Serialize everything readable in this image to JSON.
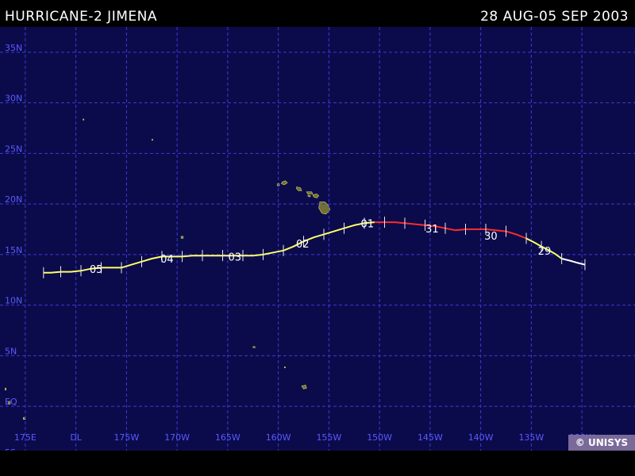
{
  "header": {
    "storm_title": "HURRICANE-2 JIMENA",
    "date_range": "28 AUG-05 SEP 2003"
  },
  "credit": "© UNISYS",
  "colors": {
    "ocean": "#0b0b4b",
    "grid": "#3a3ad8",
    "grid_label": "#5a5aff",
    "land": "#707034",
    "hurricane_track": "#ff2a2a",
    "storm_track": "#ffff66",
    "depression_track": "#ffffff",
    "day_label": "#ffffff"
  },
  "map_data": {
    "lat_labels": [
      "35N",
      "30N",
      "25N",
      "20N",
      "15N",
      "10N",
      "5N",
      "EQ",
      "5S"
    ],
    "lat_values": [
      35,
      30,
      25,
      20,
      15,
      10,
      5,
      0,
      -5
    ],
    "lon_labels": [
      "175E",
      "DL",
      "175W",
      "170W",
      "165W",
      "160W",
      "155W",
      "150W",
      "145W",
      "140W",
      "135W",
      "130W"
    ],
    "lon_values": [
      175,
      180,
      185,
      190,
      195,
      200,
      205,
      210,
      215,
      220,
      225,
      230
    ],
    "track_segments": [
      {
        "intensity": "depression",
        "points": [
          [
            230.3,
            14.0
          ],
          [
            229.5,
            14.2
          ],
          [
            228.8,
            14.4
          ],
          [
            228.0,
            14.6
          ]
        ]
      },
      {
        "intensity": "storm",
        "points": [
          [
            228.0,
            14.6
          ],
          [
            227.3,
            15.1
          ],
          [
            226.6,
            15.5
          ],
          [
            226.0,
            15.8
          ],
          [
            225.3,
            16.2
          ],
          [
            224.5,
            16.6
          ]
        ]
      },
      {
        "intensity": "hurricane",
        "points": [
          [
            224.5,
            16.6
          ],
          [
            223.5,
            17.0
          ],
          [
            222.5,
            17.3
          ],
          [
            221.5,
            17.4
          ],
          [
            220.5,
            17.5
          ],
          [
            219.5,
            17.5
          ],
          [
            218.5,
            17.5
          ],
          [
            217.5,
            17.4
          ],
          [
            216.5,
            17.6
          ],
          [
            215.5,
            17.8
          ],
          [
            214.5,
            17.9
          ],
          [
            213.5,
            18.0
          ],
          [
            212.5,
            18.1
          ],
          [
            211.5,
            18.2
          ],
          [
            210.5,
            18.2
          ],
          [
            209.5,
            18.2
          ]
        ]
      },
      {
        "intensity": "storm",
        "points": [
          [
            209.5,
            18.2
          ],
          [
            208.5,
            18.1
          ],
          [
            207.5,
            17.9
          ],
          [
            206.5,
            17.6
          ],
          [
            205.5,
            17.3
          ],
          [
            204.5,
            17.0
          ],
          [
            203.5,
            16.7
          ],
          [
            202.5,
            16.3
          ],
          [
            201.5,
            15.8
          ],
          [
            200.5,
            15.4
          ],
          [
            199.5,
            15.2
          ],
          [
            198.5,
            15.0
          ],
          [
            197.5,
            14.9
          ],
          [
            196.5,
            14.9
          ],
          [
            195.5,
            14.9
          ],
          [
            194.5,
            14.9
          ],
          [
            193.5,
            14.9
          ],
          [
            192.5,
            14.9
          ],
          [
            191.5,
            14.9
          ],
          [
            190.5,
            14.8
          ],
          [
            189.5,
            14.8
          ],
          [
            188.5,
            14.8
          ],
          [
            187.5,
            14.6
          ],
          [
            186.5,
            14.3
          ],
          [
            185.5,
            14.0
          ],
          [
            184.5,
            13.7
          ],
          [
            183.5,
            13.7
          ],
          [
            182.5,
            13.7
          ],
          [
            181.5,
            13.6
          ],
          [
            180.5,
            13.4
          ],
          [
            179.5,
            13.3
          ],
          [
            178.5,
            13.3
          ],
          [
            177.5,
            13.2
          ],
          [
            176.8,
            13.2
          ]
        ]
      }
    ],
    "six_hour_ticks": [
      [
        230.3,
        14.0
      ],
      [
        228.0,
        14.6
      ],
      [
        226.0,
        15.8
      ],
      [
        224.5,
        16.6
      ],
      [
        222.5,
        17.3
      ],
      [
        220.5,
        17.5
      ],
      [
        218.5,
        17.5
      ],
      [
        216.5,
        17.6
      ],
      [
        214.5,
        17.9
      ],
      [
        212.5,
        18.1
      ],
      [
        210.5,
        18.2
      ],
      [
        208.5,
        18.1
      ],
      [
        206.5,
        17.6
      ],
      [
        204.5,
        17.0
      ],
      [
        202.5,
        16.3
      ],
      [
        200.5,
        15.4
      ],
      [
        198.5,
        15.0
      ],
      [
        196.5,
        14.9
      ],
      [
        194.5,
        14.9
      ],
      [
        192.5,
        14.9
      ],
      [
        190.5,
        14.8
      ],
      [
        188.5,
        14.8
      ],
      [
        186.5,
        14.3
      ],
      [
        184.5,
        13.7
      ],
      [
        182.5,
        13.7
      ],
      [
        180.5,
        13.4
      ],
      [
        178.5,
        13.3
      ],
      [
        176.8,
        13.2
      ]
    ],
    "day_labels": [
      {
        "text": "29",
        "lon": 226.3,
        "lat": 15.0
      },
      {
        "text": "30",
        "lon": 221.0,
        "lat": 16.5
      },
      {
        "text": "31",
        "lon": 215.2,
        "lat": 17.2
      },
      {
        "text": "01",
        "lon": 208.8,
        "lat": 17.7
      },
      {
        "text": "02",
        "lon": 202.4,
        "lat": 15.7
      },
      {
        "text": "03",
        "lon": 195.7,
        "lat": 14.4
      },
      {
        "text": "04",
        "lon": 189.0,
        "lat": 14.2
      },
      {
        "text": "05",
        "lon": 182.0,
        "lat": 13.2
      }
    ],
    "land_features": [
      {
        "name": "Kauai",
        "points": [
          [
            200.4,
            22.2
          ],
          [
            200.7,
            22.3
          ],
          [
            200.9,
            22.1
          ],
          [
            200.6,
            21.9
          ],
          [
            200.3,
            22.0
          ]
        ]
      },
      {
        "name": "Niihau",
        "points": [
          [
            199.9,
            22.0
          ],
          [
            200.1,
            22.0
          ],
          [
            200.1,
            21.8
          ],
          [
            199.9,
            21.8
          ]
        ]
      },
      {
        "name": "Oahu",
        "points": [
          [
            201.8,
            21.7
          ],
          [
            202.2,
            21.6
          ],
          [
            202.3,
            21.3
          ],
          [
            202.0,
            21.3
          ],
          [
            201.8,
            21.5
          ]
        ]
      },
      {
        "name": "Molokai",
        "points": [
          [
            202.8,
            21.2
          ],
          [
            203.3,
            21.2
          ],
          [
            203.4,
            21.0
          ],
          [
            202.9,
            21.0
          ]
        ]
      },
      {
        "name": "Maui",
        "points": [
          [
            203.4,
            20.9
          ],
          [
            203.8,
            21.0
          ],
          [
            204.0,
            20.8
          ],
          [
            203.8,
            20.6
          ],
          [
            203.5,
            20.7
          ]
        ]
      },
      {
        "name": "Lanai",
        "points": [
          [
            203.0,
            20.9
          ],
          [
            203.2,
            20.8
          ],
          [
            203.1,
            20.7
          ],
          [
            202.9,
            20.8
          ]
        ]
      },
      {
        "name": "Hawaii",
        "points": [
          [
            204.1,
            20.2
          ],
          [
            204.6,
            20.2
          ],
          [
            205.0,
            19.8
          ],
          [
            205.1,
            19.4
          ],
          [
            204.7,
            19.0
          ],
          [
            204.3,
            19.1
          ],
          [
            204.0,
            19.6
          ]
        ]
      },
      {
        "name": "Johnston",
        "points": [
          [
            190.4,
            16.8
          ],
          [
            190.6,
            16.8
          ],
          [
            190.6,
            16.6
          ],
          [
            190.4,
            16.6
          ]
        ]
      },
      {
        "name": "Palmyra",
        "points": [
          [
            197.5,
            5.9
          ],
          [
            197.7,
            5.9
          ],
          [
            197.7,
            5.8
          ],
          [
            197.5,
            5.8
          ]
        ]
      },
      {
        "name": "Kiritimati",
        "points": [
          [
            202.3,
            2.0
          ],
          [
            202.7,
            2.1
          ],
          [
            202.8,
            1.8
          ],
          [
            202.5,
            1.7
          ]
        ]
      },
      {
        "name": "Fanning",
        "points": [
          [
            200.6,
            3.9
          ],
          [
            200.7,
            3.9
          ],
          [
            200.7,
            3.8
          ],
          [
            200.6,
            3.8
          ]
        ]
      },
      {
        "name": "Gilbert-1",
        "points": [
          [
            173.0,
            1.8
          ],
          [
            173.1,
            1.8
          ],
          [
            173.1,
            1.6
          ],
          [
            173.0,
            1.6
          ]
        ]
      },
      {
        "name": "Gilbert-2",
        "points": [
          [
            173.3,
            0.5
          ],
          [
            173.5,
            0.5
          ],
          [
            173.5,
            0.2
          ],
          [
            173.3,
            0.2
          ]
        ]
      },
      {
        "name": "Gilbert-3",
        "points": [
          [
            174.8,
            -1.1
          ],
          [
            175.0,
            -1.1
          ],
          [
            175.0,
            -1.3
          ],
          [
            174.8,
            -1.3
          ]
        ]
      },
      {
        "name": "Wake",
        "points": [
          [
            180.7,
            28.4
          ],
          [
            180.8,
            28.4
          ],
          [
            180.8,
            28.3
          ],
          [
            180.7,
            28.3
          ]
        ]
      },
      {
        "name": "Kingman",
        "points": [
          [
            187.5,
            26.4
          ],
          [
            187.6,
            26.4
          ],
          [
            187.6,
            26.3
          ],
          [
            187.5,
            26.3
          ]
        ]
      }
    ]
  }
}
